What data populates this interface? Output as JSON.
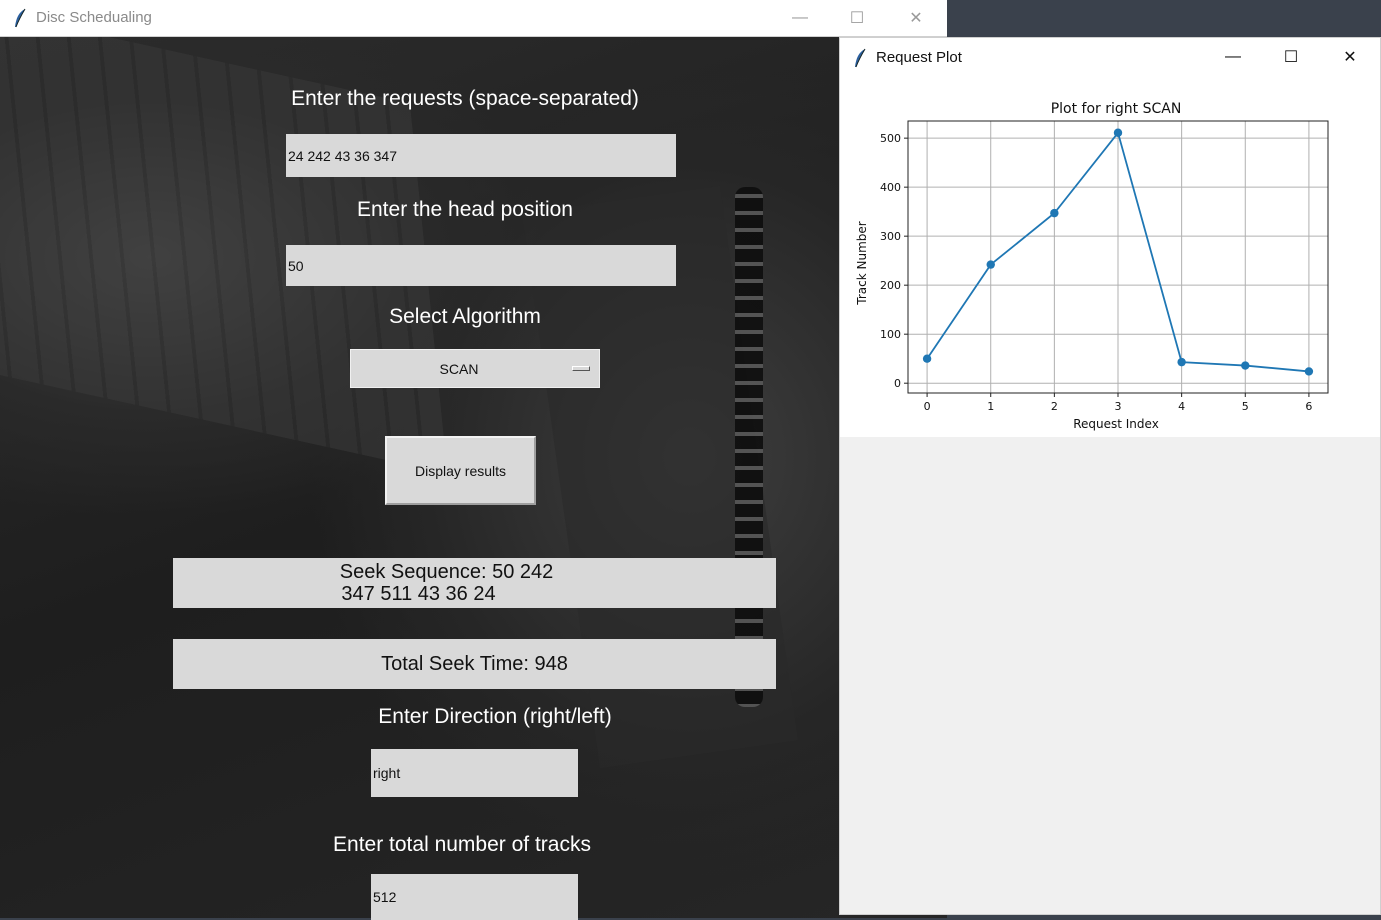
{
  "main_window": {
    "title": "Disc Schedualing",
    "controls": {
      "minimize": "—",
      "maximize": "☐",
      "close": "✕"
    }
  },
  "form": {
    "requests_label": "Enter the requests (space-separated)",
    "requests_value": "24 242 43 36 347",
    "head_label": "Enter the head position",
    "head_value": "50",
    "algorithm_label": "Select Algorithm",
    "algorithm_value": "SCAN",
    "display_button": "Display results",
    "seek_sequence_line1": "Seek Sequence: 50 242",
    "seek_sequence_line2": "347 511 43 36 24",
    "total_seek_time": "Total Seek Time: 948",
    "direction_label": "Enter Direction (right/left)",
    "direction_value": "right",
    "tracks_label": "Enter total number of tracks",
    "tracks_value": "512"
  },
  "plot_window": {
    "title": "Request Plot",
    "controls": {
      "minimize": "—",
      "maximize": "☐",
      "close": "✕"
    }
  },
  "chart_data": {
    "type": "line",
    "title": "Plot for right SCAN",
    "xlabel": "Request Index",
    "ylabel": "Track Number",
    "x": [
      0,
      1,
      2,
      3,
      4,
      5,
      6
    ],
    "series": [
      {
        "values": [
          50,
          242,
          347,
          511,
          43,
          36,
          24
        ],
        "color": "#1f77b4",
        "marker": "circle"
      }
    ],
    "xticks": [
      "0",
      "1",
      "2",
      "3",
      "4",
      "5",
      "6"
    ],
    "yticks": [
      "0",
      "100",
      "200",
      "300",
      "400",
      "500"
    ],
    "xlim": [
      -0.3,
      6.3
    ],
    "ylim": [
      -20,
      535
    ],
    "grid": true
  }
}
